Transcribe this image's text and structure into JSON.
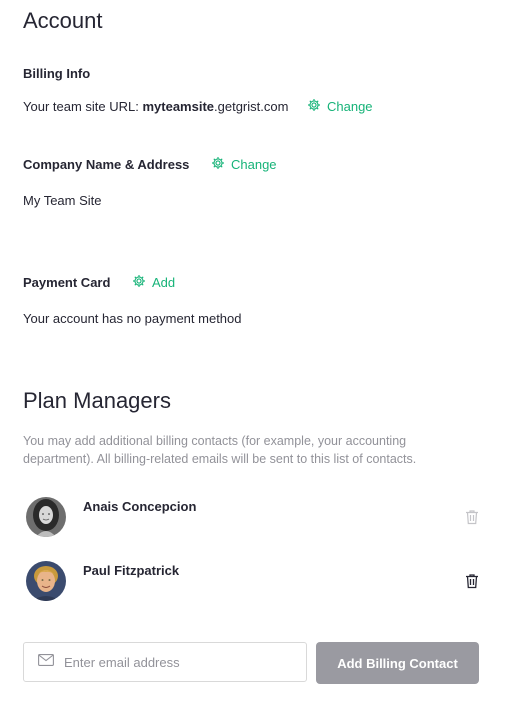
{
  "account": {
    "title": "Account",
    "billing_info": {
      "heading": "Billing Info",
      "url_prefix": "Your team site URL: ",
      "url_bold": "myteamsite",
      "url_suffix": ".getgrist.com",
      "change_label": "Change"
    },
    "company": {
      "heading": "Company Name & Address",
      "change_label": "Change",
      "name": "My Team Site"
    },
    "payment": {
      "heading": "Payment Card",
      "add_label": "Add",
      "status": "Your account has no payment method"
    }
  },
  "plan_managers": {
    "title": "Plan Managers",
    "description": "You may add additional billing contacts (for example, your accounting department). All billing-related emails will be sent to this list of contacts.",
    "members": [
      {
        "name": "Anais Concepcion",
        "email": "",
        "avatar": "avatar-woman",
        "delete_disabled": true
      },
      {
        "name": "Paul Fitzpatrick",
        "email": "",
        "avatar": "avatar-man",
        "delete_disabled": false
      }
    ],
    "email_placeholder": "Enter email address",
    "add_button": "Add Billing Contact"
  },
  "colors": {
    "accent": "#16b378",
    "muted": "#929299",
    "button_disabled": "#9a9aa1"
  }
}
